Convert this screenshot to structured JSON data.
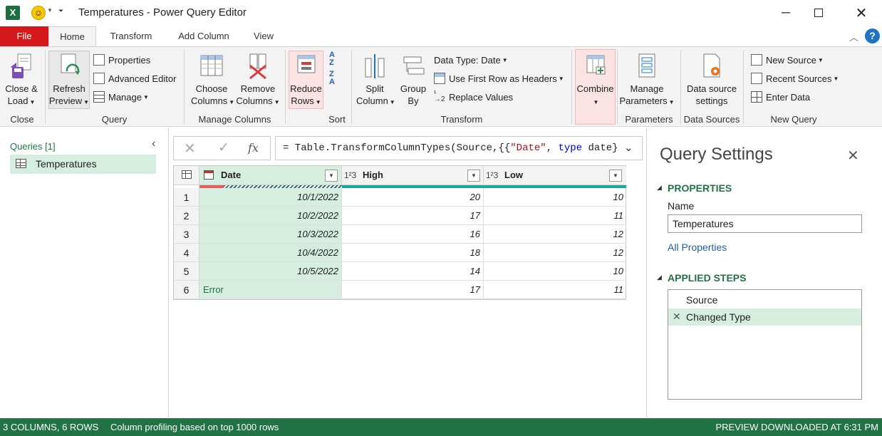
{
  "window": {
    "title": "Temperatures - Power Query Editor"
  },
  "tabs": [
    "File",
    "Home",
    "Transform",
    "Add Column",
    "View"
  ],
  "ribbon": {
    "close_load": [
      "Close &",
      "Load"
    ],
    "close_group": "Close",
    "refresh_preview": [
      "Refresh",
      "Preview"
    ],
    "properties": "Properties",
    "advanced_editor": "Advanced Editor",
    "manage": "Manage",
    "query_group": "Query",
    "choose_columns": [
      "Choose",
      "Columns"
    ],
    "remove_columns": [
      "Remove",
      "Columns"
    ],
    "manage_columns_group": "Manage Columns",
    "reduce_rows": [
      "Reduce",
      "Rows"
    ],
    "sort_group": "Sort",
    "split_column": [
      "Split",
      "Column"
    ],
    "group_by": [
      "Group",
      "By"
    ],
    "data_type": "Data Type: Date",
    "use_first_row": "Use First Row as Headers",
    "replace_values": "Replace Values",
    "transform_group": "Transform",
    "combine": "Combine",
    "manage_parameters": [
      "Manage",
      "Parameters"
    ],
    "parameters_group": "Parameters",
    "data_source_settings": [
      "Data source",
      "settings"
    ],
    "data_sources_group": "Data Sources",
    "new_source": "New Source",
    "recent_sources": "Recent Sources",
    "enter_data": "Enter Data",
    "new_query_group": "New Query"
  },
  "queries": {
    "header": "Queries [1]",
    "items": [
      "Temperatures"
    ]
  },
  "formula": {
    "fx": "fx",
    "prefix": "= Table.TransformColumnTypes(Source,{{",
    "str": "\"Date\"",
    "mid": ", ",
    "kw": "type",
    "end": " date}"
  },
  "table": {
    "columns": [
      {
        "name": "Date",
        "type_icon": "calendar-icon"
      },
      {
        "name": "High",
        "type_icon": "123"
      },
      {
        "name": "Low",
        "type_icon": "123"
      }
    ],
    "rows": [
      {
        "n": "1",
        "date": "10/1/2022",
        "high": "20",
        "low": "10"
      },
      {
        "n": "2",
        "date": "10/2/2022",
        "high": "17",
        "low": "11"
      },
      {
        "n": "3",
        "date": "10/3/2022",
        "high": "16",
        "low": "12"
      },
      {
        "n": "4",
        "date": "10/4/2022",
        "high": "18",
        "low": "12"
      },
      {
        "n": "5",
        "date": "10/5/2022",
        "high": "14",
        "low": "10"
      },
      {
        "n": "6",
        "date": "Error",
        "high": "17",
        "low": "11"
      }
    ]
  },
  "settings": {
    "title": "Query Settings",
    "properties_header": "PROPERTIES",
    "name_label": "Name",
    "name_value": "Temperatures",
    "all_properties": "All Properties",
    "applied_steps_header": "APPLIED STEPS",
    "steps": [
      "Source",
      "Changed Type"
    ]
  },
  "status": {
    "columns_rows": "3 COLUMNS, 6 ROWS",
    "profiling": "Column profiling based on top 1000 rows",
    "preview": "PREVIEW DOWNLOADED AT 6:31 PM"
  },
  "colors": {
    "accent": "#217346",
    "file_tab": "#d4181c",
    "selected": "#d6eedf",
    "error": "#217346",
    "quality_bar": "#1aa89c"
  }
}
